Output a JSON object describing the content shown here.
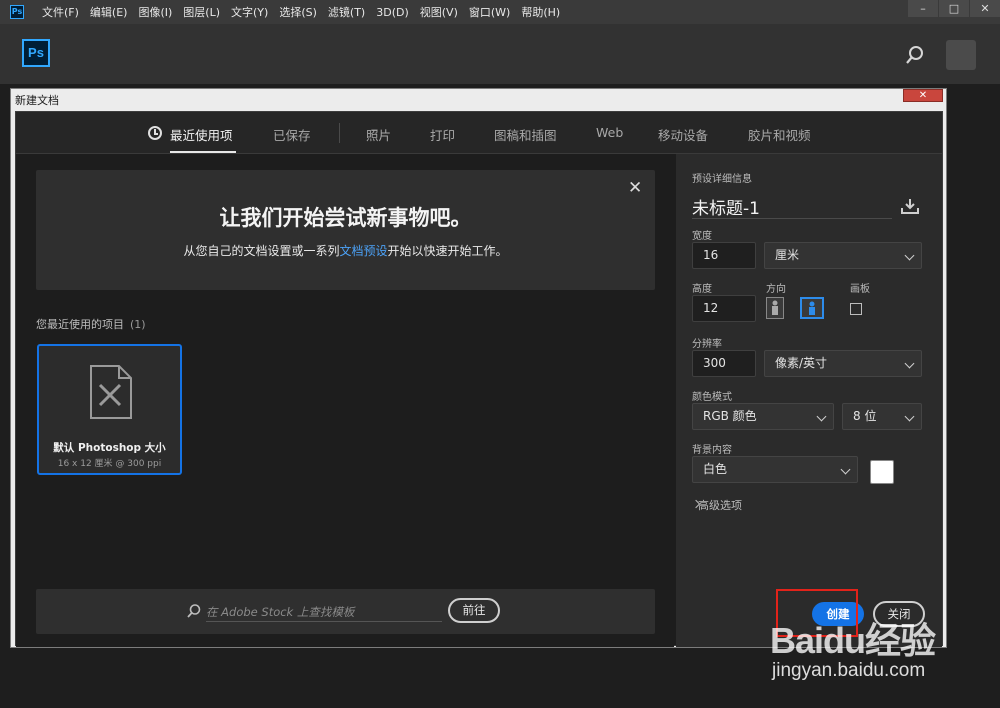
{
  "menubar": {
    "app_icon": "Ps",
    "items": [
      "文件(F)",
      "编辑(E)",
      "图像(I)",
      "图层(L)",
      "文字(Y)",
      "选择(S)",
      "滤镜(T)",
      "3D(D)",
      "视图(V)",
      "窗口(W)",
      "帮助(H)"
    ],
    "window_controls": [
      "minimize-icon",
      "maximize-icon",
      "close-icon"
    ]
  },
  "home": {
    "logo": "Ps",
    "search_icon": "search-icon",
    "avatar": "avatar"
  },
  "dialog": {
    "title": "新建文档",
    "tabs": [
      {
        "label": "最近使用项",
        "active": true
      },
      {
        "label": "已保存"
      },
      {
        "label": "照片"
      },
      {
        "label": "打印"
      },
      {
        "label": "图稿和插图"
      },
      {
        "label": "Web"
      },
      {
        "label": "移动设备"
      },
      {
        "label": "胶片和视频"
      }
    ],
    "banner": {
      "title": "让我们开始尝试新事物吧。",
      "sub_before": "从您自己的文档设置或一系列",
      "sub_link": "文档预设",
      "sub_after": "开始以快速开始工作。",
      "close": "✕"
    },
    "recent": {
      "label": "您最近使用的项目",
      "count": "(1)",
      "items": [
        {
          "name": "默认 Photoshop 大小",
          "meta": "16 x 12 厘米 @ 300 ppi"
        }
      ]
    },
    "stock": {
      "placeholder": "在 Adobe Stock 上查找模板",
      "go_label": "前往"
    },
    "preset": {
      "header": "预设详细信息",
      "name": "未标题-1",
      "width_label": "宽度",
      "width_value": "16",
      "width_unit": "厘米",
      "height_label": "高度",
      "height_value": "12",
      "orientation_label": "方向",
      "artboard_label": "画板",
      "resolution_label": "分辨率",
      "resolution_value": "300",
      "resolution_unit": "像素/英寸",
      "color_mode_label": "颜色模式",
      "color_mode": "RGB 颜色",
      "bit_depth": "8 位",
      "background_label": "背景内容",
      "background": "白色",
      "background_color": "#ffffff",
      "advanced_label": "高级选项"
    },
    "buttons": {
      "create": "创建",
      "close": "关闭"
    }
  },
  "watermark": {
    "logo": "Baidu经验",
    "url": "jingyan.baidu.com"
  },
  "colors": {
    "accent": "#1473e6",
    "link": "#4ca2f7",
    "highlight": "#e2231a",
    "ps_blue": "#31a8ff"
  }
}
